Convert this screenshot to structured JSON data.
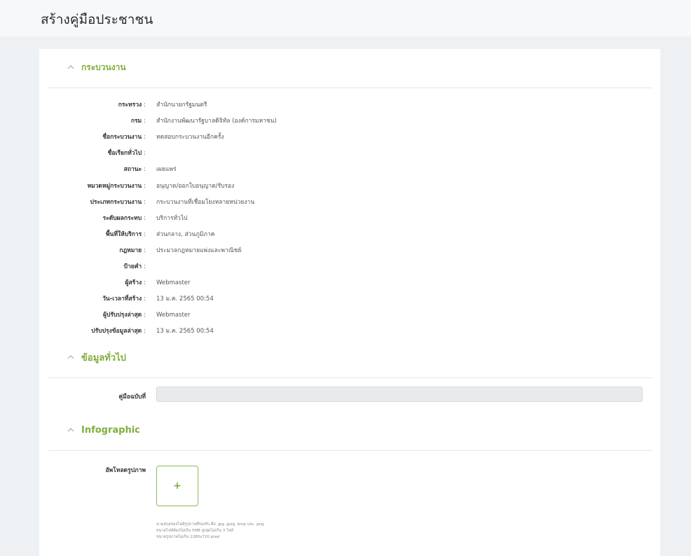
{
  "page": {
    "title": "สร้างคู่มือประชาชน"
  },
  "sections": {
    "process": {
      "title": "กระบวนงาน"
    },
    "general": {
      "title": "ข้อมูลทั่วไป"
    },
    "infographic": {
      "title": "Infographic"
    }
  },
  "process_rows": [
    {
      "label": "กระทรวง",
      "value": "สำนักนายกรัฐมนตรี"
    },
    {
      "label": "กรม",
      "value": "สำนักงานพัฒนารัฐบาลดิจิทัล (องค์การมหาชน)"
    },
    {
      "label": "ชื่อกระบวนงาน",
      "value": "ทดสอบกระบวนงานอีกครั้ง"
    },
    {
      "label": "ชื่อเรียกทั่วไป",
      "value": ""
    },
    {
      "label": "สถานะ",
      "value": "เผยแพร่"
    },
    {
      "label": "หมวดหมู่กระบวนงาน",
      "value": "อนุญาต/ออกใบอนุญาต/รับรอง"
    },
    {
      "label": "ประเภทกระบวนงาน",
      "value": "กระบวนงานที่เชื่อมโยงหลายหน่วยงาน"
    },
    {
      "label": "ระดับผลกระทบ",
      "value": "บริการทั่วไป"
    },
    {
      "label": "พื้นที่ให้บริการ",
      "value": "ส่วนกลาง, ส่วนภูมิภาค"
    },
    {
      "label": "กฎหมาย",
      "value": "ประมวลกฎหมายแพ่งและพาณิชย์"
    },
    {
      "label": "ป้ายคำ",
      "value": ""
    },
    {
      "label": "ผู้สร้าง",
      "value": "Webmaster"
    },
    {
      "label": "วัน-เวลาที่สร้าง",
      "value": "13 ม.ค. 2565 00:54"
    },
    {
      "label": "ผู้ปรับปรุงล่าสุด",
      "value": "Webmaster"
    },
    {
      "label": "ปรับปรุงข้อมูลล่าสุด",
      "value": "13 ม.ค. 2565 00:54"
    }
  ],
  "colon": ":",
  "general": {
    "manual_no_label": "คู่มือฉบับที่",
    "manual_no_value": ""
  },
  "infographic": {
    "upload_label": "อัพโหลดรูปภาพ",
    "upload_button": "+",
    "hints": [
      "นามสกุลของไฟล์รูปภาพที่รองรับ คือ .jpg .jpeg .bmp และ .png",
      "ขนาดไฟล์ต้องไม่เกิน 5MB สูงสุดไม่เกิน 3 ไฟล์",
      "ขนาดรูปภาพไม่เกิน 1280x720 pixel"
    ]
  },
  "colors": {
    "accent": "#7fae3c",
    "background": "#eef1f4",
    "card": "#ffffff"
  },
  "icons": {
    "section_toggle": "chevron-up-icon"
  }
}
